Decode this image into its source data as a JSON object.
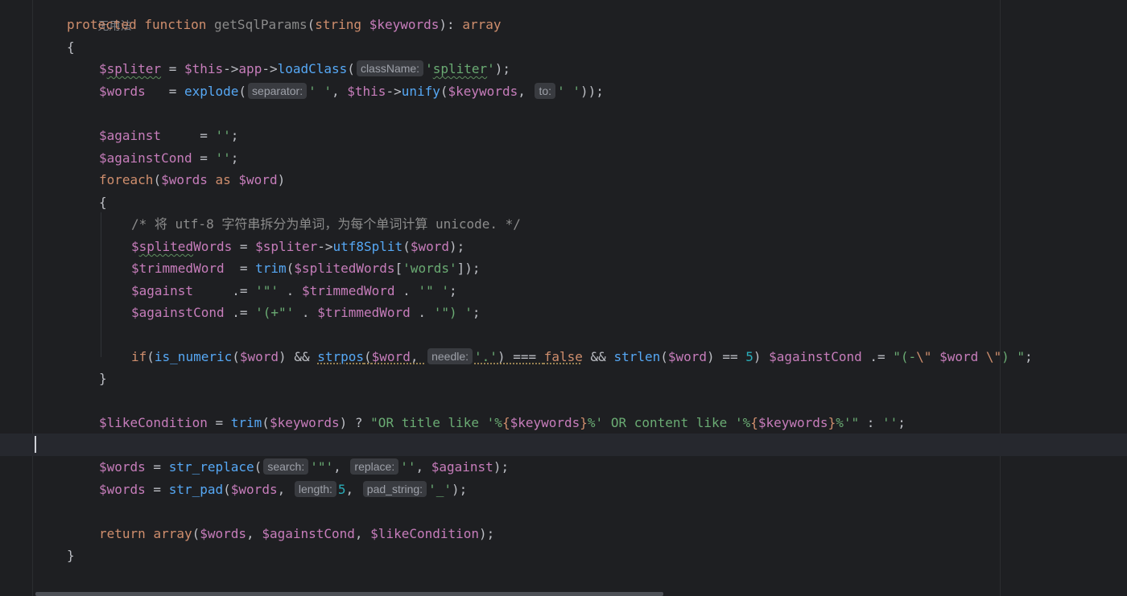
{
  "editor": {
    "top_comment": "无用法",
    "lines": [
      {
        "id": "sig",
        "tokens": [
          {
            "t": "protected ",
            "c": "kw"
          },
          {
            "t": "function ",
            "c": "kw"
          },
          {
            "t": "getSqlParams",
            "c": "decl"
          },
          {
            "t": "(",
            "c": "op"
          },
          {
            "t": "string ",
            "c": "kw"
          },
          {
            "t": "$keywords",
            "c": "var"
          },
          {
            "t": "): ",
            "c": "op"
          },
          {
            "t": "array",
            "c": "kw"
          }
        ]
      },
      {
        "id": "open-brace",
        "tokens": [
          {
            "t": "{",
            "c": "op"
          }
        ]
      },
      {
        "id": "spliter",
        "tokens": [
          {
            "t": "$",
            "c": "var"
          },
          {
            "t": "spliter",
            "c": "var typo"
          },
          {
            "t": " = ",
            "c": "op"
          },
          {
            "t": "$this",
            "c": "var"
          },
          {
            "t": "->",
            "c": "op"
          },
          {
            "t": "app",
            "c": "var"
          },
          {
            "t": "->",
            "c": "op"
          },
          {
            "t": "loadClass",
            "c": "fn"
          },
          {
            "t": "(",
            "c": "op"
          },
          {
            "t": "className:",
            "c": "hint"
          },
          {
            "t": "'",
            "c": "str"
          },
          {
            "t": "spliter",
            "c": "str typo"
          },
          {
            "t": "'",
            "c": "str"
          },
          {
            "t": ");",
            "c": "op"
          }
        ]
      },
      {
        "id": "words-explode",
        "tokens": [
          {
            "t": "$words",
            "c": "var"
          },
          {
            "t": "   = ",
            "c": "op"
          },
          {
            "t": "explode",
            "c": "fn"
          },
          {
            "t": "(",
            "c": "op"
          },
          {
            "t": "separator:",
            "c": "hint"
          },
          {
            "t": "' '",
            "c": "str"
          },
          {
            "t": ", ",
            "c": "op"
          },
          {
            "t": "$this",
            "c": "var"
          },
          {
            "t": "->",
            "c": "op"
          },
          {
            "t": "unify",
            "c": "fn"
          },
          {
            "t": "(",
            "c": "op"
          },
          {
            "t": "$keywords",
            "c": "var"
          },
          {
            "t": ", ",
            "c": "op"
          },
          {
            "t": "to:",
            "c": "hint"
          },
          {
            "t": "' '",
            "c": "str"
          },
          {
            "t": "));",
            "c": "op"
          }
        ]
      },
      {
        "id": "blank-1",
        "tokens": []
      },
      {
        "id": "against",
        "tokens": [
          {
            "t": "$against",
            "c": "var"
          },
          {
            "t": "     = ",
            "c": "op"
          },
          {
            "t": "''",
            "c": "str"
          },
          {
            "t": ";",
            "c": "op"
          }
        ]
      },
      {
        "id": "against-cond",
        "tokens": [
          {
            "t": "$againstCond",
            "c": "var"
          },
          {
            "t": " = ",
            "c": "op"
          },
          {
            "t": "''",
            "c": "str"
          },
          {
            "t": ";",
            "c": "op"
          }
        ]
      },
      {
        "id": "foreach",
        "tokens": [
          {
            "t": "foreach",
            "c": "kw"
          },
          {
            "t": "(",
            "c": "op"
          },
          {
            "t": "$words",
            "c": "var"
          },
          {
            "t": " as ",
            "c": "kw"
          },
          {
            "t": "$word",
            "c": "var"
          },
          {
            "t": ")",
            "c": "op"
          }
        ]
      },
      {
        "id": "foreach-open",
        "tokens": [
          {
            "t": "{",
            "c": "op"
          }
        ]
      },
      {
        "id": "comment",
        "tokens": [
          {
            "t": "/* 将 utf-8 字符串拆分为单词，为每个单词计算 unicode. */",
            "c": "cmt"
          }
        ]
      },
      {
        "id": "splited-words",
        "tokens": [
          {
            "t": "$",
            "c": "var"
          },
          {
            "t": "splited",
            "c": "var typo"
          },
          {
            "t": "Words",
            "c": "var"
          },
          {
            "t": " = ",
            "c": "op"
          },
          {
            "t": "$spliter",
            "c": "var"
          },
          {
            "t": "->",
            "c": "op"
          },
          {
            "t": "utf8Split",
            "c": "fn"
          },
          {
            "t": "(",
            "c": "op"
          },
          {
            "t": "$word",
            "c": "var"
          },
          {
            "t": ");",
            "c": "op"
          }
        ]
      },
      {
        "id": "trimmed-word",
        "tokens": [
          {
            "t": "$trimmedWord",
            "c": "var"
          },
          {
            "t": "  = ",
            "c": "op"
          },
          {
            "t": "trim",
            "c": "fn"
          },
          {
            "t": "(",
            "c": "op"
          },
          {
            "t": "$splitedWords",
            "c": "var"
          },
          {
            "t": "[",
            "c": "op"
          },
          {
            "t": "'words'",
            "c": "str"
          },
          {
            "t": "]);",
            "c": "op"
          }
        ]
      },
      {
        "id": "against-append",
        "tokens": [
          {
            "t": "$against",
            "c": "var"
          },
          {
            "t": "     .= ",
            "c": "op"
          },
          {
            "t": "'\"'",
            "c": "str"
          },
          {
            "t": " . ",
            "c": "op"
          },
          {
            "t": "$trimmedWord",
            "c": "var"
          },
          {
            "t": " . ",
            "c": "op"
          },
          {
            "t": "'\" '",
            "c": "str"
          },
          {
            "t": ";",
            "c": "op"
          }
        ]
      },
      {
        "id": "against-cond-append",
        "tokens": [
          {
            "t": "$againstCond",
            "c": "var"
          },
          {
            "t": " .= ",
            "c": "op"
          },
          {
            "t": "'(+\"'",
            "c": "str"
          },
          {
            "t": " . ",
            "c": "op"
          },
          {
            "t": "$trimmedWord",
            "c": "var"
          },
          {
            "t": " . ",
            "c": "op"
          },
          {
            "t": "'\") '",
            "c": "str"
          },
          {
            "t": ";",
            "c": "op"
          }
        ]
      },
      {
        "id": "blank-2",
        "tokens": []
      },
      {
        "id": "if-numeric",
        "tokens": [
          {
            "t": "if",
            "c": "kw"
          },
          {
            "t": "(",
            "c": "op"
          },
          {
            "t": "is_numeric",
            "c": "fn"
          },
          {
            "t": "(",
            "c": "op"
          },
          {
            "t": "$word",
            "c": "var"
          },
          {
            "t": ") && ",
            "c": "op"
          },
          {
            "t": "strpos",
            "c": "fn warn"
          },
          {
            "t": "(",
            "c": "op warn"
          },
          {
            "t": "$word",
            "c": "var warn"
          },
          {
            "t": ", ",
            "c": "op warn"
          },
          {
            "t": "needle:",
            "c": "hint"
          },
          {
            "t": "'.'",
            "c": "str warn"
          },
          {
            "t": ") === ",
            "c": "op warn"
          },
          {
            "t": "false",
            "c": "kw warn"
          },
          {
            "t": " && ",
            "c": "op"
          },
          {
            "t": "strlen",
            "c": "fn"
          },
          {
            "t": "(",
            "c": "op"
          },
          {
            "t": "$word",
            "c": "var"
          },
          {
            "t": ") == ",
            "c": "op"
          },
          {
            "t": "5",
            "c": "num"
          },
          {
            "t": ") ",
            "c": "op"
          },
          {
            "t": "$againstCond",
            "c": "var"
          },
          {
            "t": " .= ",
            "c": "op"
          },
          {
            "t": "\"(-",
            "c": "str"
          },
          {
            "t": "\\\"",
            "c": "escape"
          },
          {
            "t": " ",
            "c": "str"
          },
          {
            "t": "$word",
            "c": "var"
          },
          {
            "t": " ",
            "c": "str"
          },
          {
            "t": "\\\"",
            "c": "escape"
          },
          {
            "t": ") \"",
            "c": "str"
          },
          {
            "t": ";",
            "c": "op"
          }
        ]
      },
      {
        "id": "foreach-close",
        "tokens": [
          {
            "t": "}",
            "c": "op"
          }
        ]
      },
      {
        "id": "blank-3",
        "tokens": []
      },
      {
        "id": "like-condition",
        "tokens": [
          {
            "t": "$likeCondition",
            "c": "var"
          },
          {
            "t": " = ",
            "c": "op"
          },
          {
            "t": "trim",
            "c": "fn"
          },
          {
            "t": "(",
            "c": "op"
          },
          {
            "t": "$keywords",
            "c": "var"
          },
          {
            "t": ") ? ",
            "c": "op"
          },
          {
            "t": "\"OR title like '%",
            "c": "str"
          },
          {
            "t": "{",
            "c": "escape"
          },
          {
            "t": "$keywords",
            "c": "var"
          },
          {
            "t": "}",
            "c": "escape"
          },
          {
            "t": "%' OR content like '%",
            "c": "str"
          },
          {
            "t": "{",
            "c": "escape"
          },
          {
            "t": "$keywords",
            "c": "var"
          },
          {
            "t": "}",
            "c": "escape"
          },
          {
            "t": "%'\"",
            "c": "str"
          },
          {
            "t": " : ",
            "c": "op"
          },
          {
            "t": "''",
            "c": "str"
          },
          {
            "t": ";",
            "c": "op"
          }
        ]
      },
      {
        "id": "blank-current",
        "tokens": []
      },
      {
        "id": "words-replace",
        "tokens": [
          {
            "t": "$words",
            "c": "var"
          },
          {
            "t": " = ",
            "c": "op"
          },
          {
            "t": "str_replace",
            "c": "fn"
          },
          {
            "t": "(",
            "c": "op"
          },
          {
            "t": "search:",
            "c": "hint"
          },
          {
            "t": "'\"'",
            "c": "str"
          },
          {
            "t": ", ",
            "c": "op"
          },
          {
            "t": "replace:",
            "c": "hint"
          },
          {
            "t": "''",
            "c": "str"
          },
          {
            "t": ", ",
            "c": "op"
          },
          {
            "t": "$against",
            "c": "var"
          },
          {
            "t": ");",
            "c": "op"
          }
        ]
      },
      {
        "id": "words-pad",
        "tokens": [
          {
            "t": "$words",
            "c": "var"
          },
          {
            "t": " = ",
            "c": "op"
          },
          {
            "t": "str_pad",
            "c": "fn"
          },
          {
            "t": "(",
            "c": "op"
          },
          {
            "t": "$words",
            "c": "var"
          },
          {
            "t": ", ",
            "c": "op"
          },
          {
            "t": "length:",
            "c": "hint"
          },
          {
            "t": "5",
            "c": "num"
          },
          {
            "t": ", ",
            "c": "op"
          },
          {
            "t": "pad_string:",
            "c": "hint"
          },
          {
            "t": "'_'",
            "c": "str"
          },
          {
            "t": ");",
            "c": "op"
          }
        ]
      },
      {
        "id": "blank-4",
        "tokens": []
      },
      {
        "id": "return",
        "tokens": [
          {
            "t": "return ",
            "c": "kw"
          },
          {
            "t": "array",
            "c": "kw"
          },
          {
            "t": "(",
            "c": "op"
          },
          {
            "t": "$words",
            "c": "var"
          },
          {
            "t": ", ",
            "c": "op"
          },
          {
            "t": "$againstCond",
            "c": "var"
          },
          {
            "t": ", ",
            "c": "op"
          },
          {
            "t": "$likeCondition",
            "c": "var"
          },
          {
            "t": ");",
            "c": "op"
          }
        ]
      },
      {
        "id": "close-brace",
        "tokens": [
          {
            "t": "}",
            "c": "op"
          }
        ]
      }
    ]
  }
}
